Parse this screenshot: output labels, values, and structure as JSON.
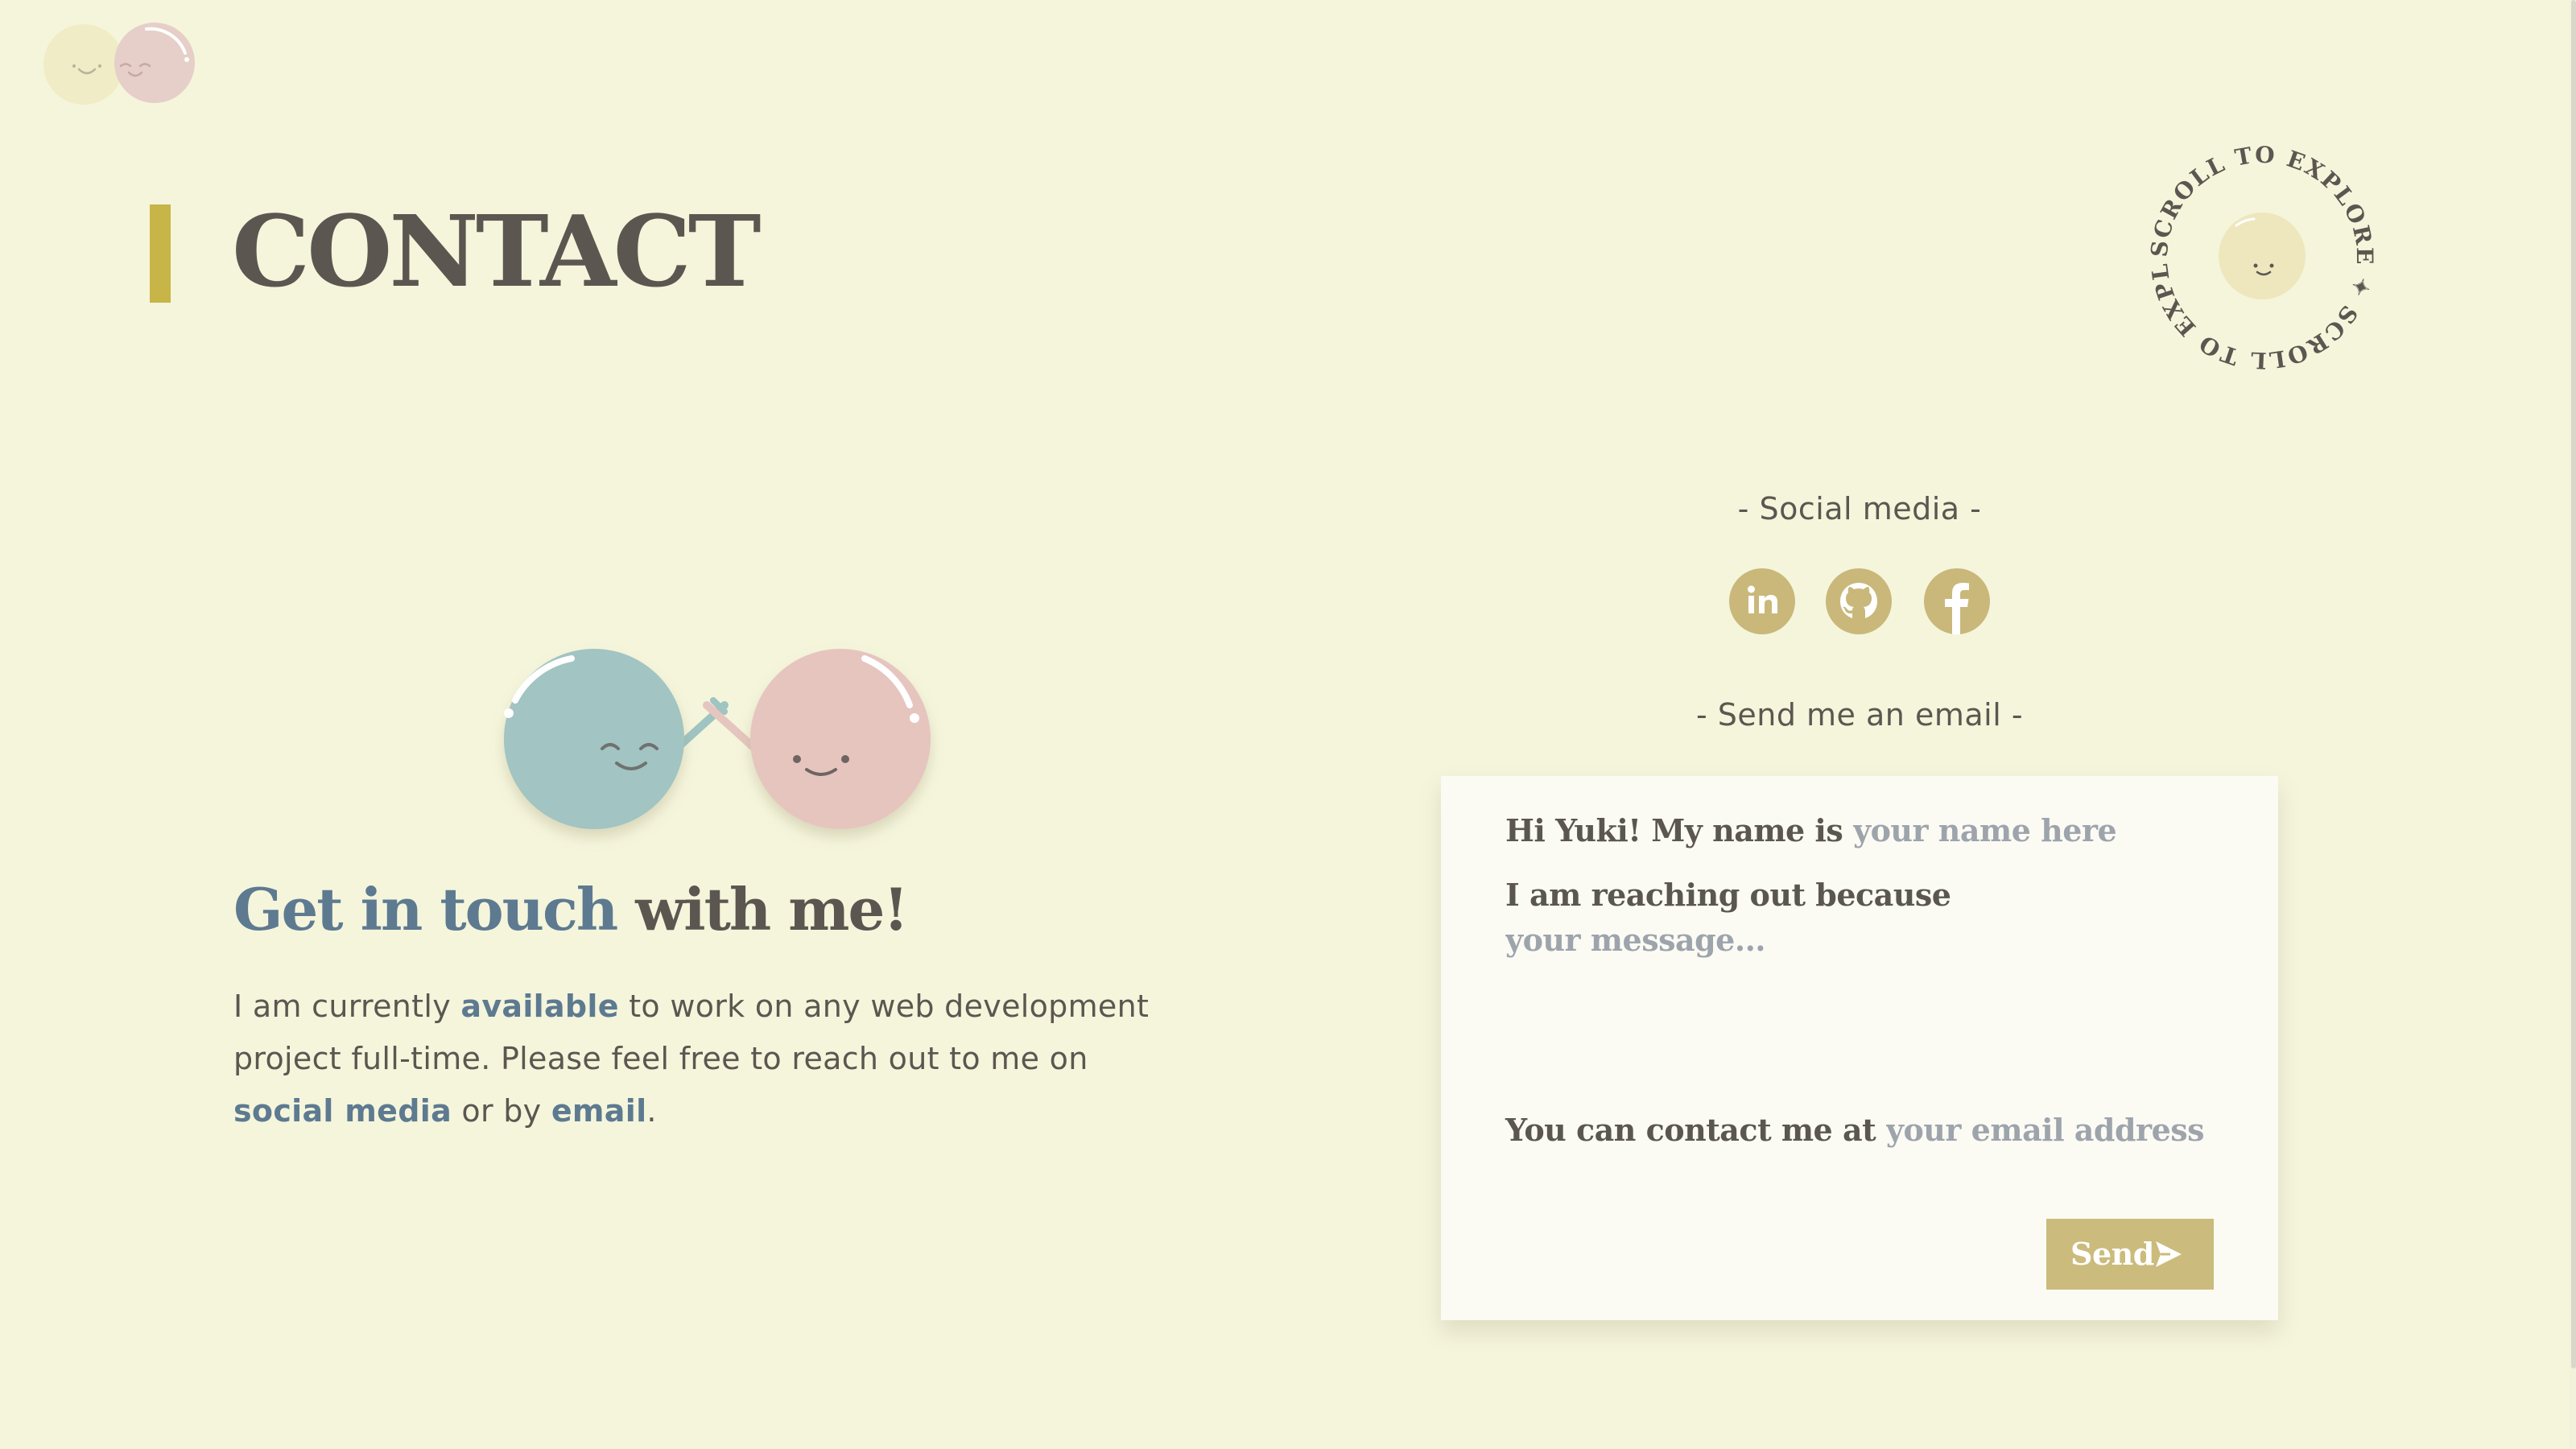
{
  "header": {
    "logo_alt": "Yuki logo"
  },
  "page": {
    "title": "CONTACT"
  },
  "scroll_badge": {
    "text": "SCROLL TO EXPLORE ✦ SCROLL TO EXPLORE ✦"
  },
  "touch": {
    "heading_accent": "Get in touch",
    "heading_rest": " with me!"
  },
  "intro": {
    "part1": "I am currently ",
    "link_available": "available",
    "part2": " to work on any web development project full-time. Please feel free to reach out to me on ",
    "link_social": "social media",
    "part3": " or by ",
    "link_email": "email",
    "part4": "."
  },
  "social": {
    "label": "- Social media -",
    "items": [
      {
        "name": "LinkedIn",
        "icon": "linkedin-icon"
      },
      {
        "name": "GitHub",
        "icon": "github-icon"
      },
      {
        "name": "Facebook",
        "icon": "facebook-icon"
      }
    ]
  },
  "email_form": {
    "label": "- Send me an email -",
    "name_prefix": "Hi Yuki! My name is ",
    "name_placeholder": "your name here",
    "reason_prefix": "I am reaching out because",
    "message_placeholder": "your message...",
    "contact_prefix": "You can contact me at ",
    "email_placeholder": "your email address",
    "send_label": "Send",
    "send_icon": "paper-plane-icon"
  },
  "colors": {
    "background": "#f5f5dc",
    "accent_gold": "#c8b547",
    "icon_gold": "#c9b87a",
    "accent_blue": "#5d7a90",
    "text": "#5b5750",
    "bubble_blue": "#a2c4c2",
    "bubble_pink": "#e6c5bf"
  }
}
